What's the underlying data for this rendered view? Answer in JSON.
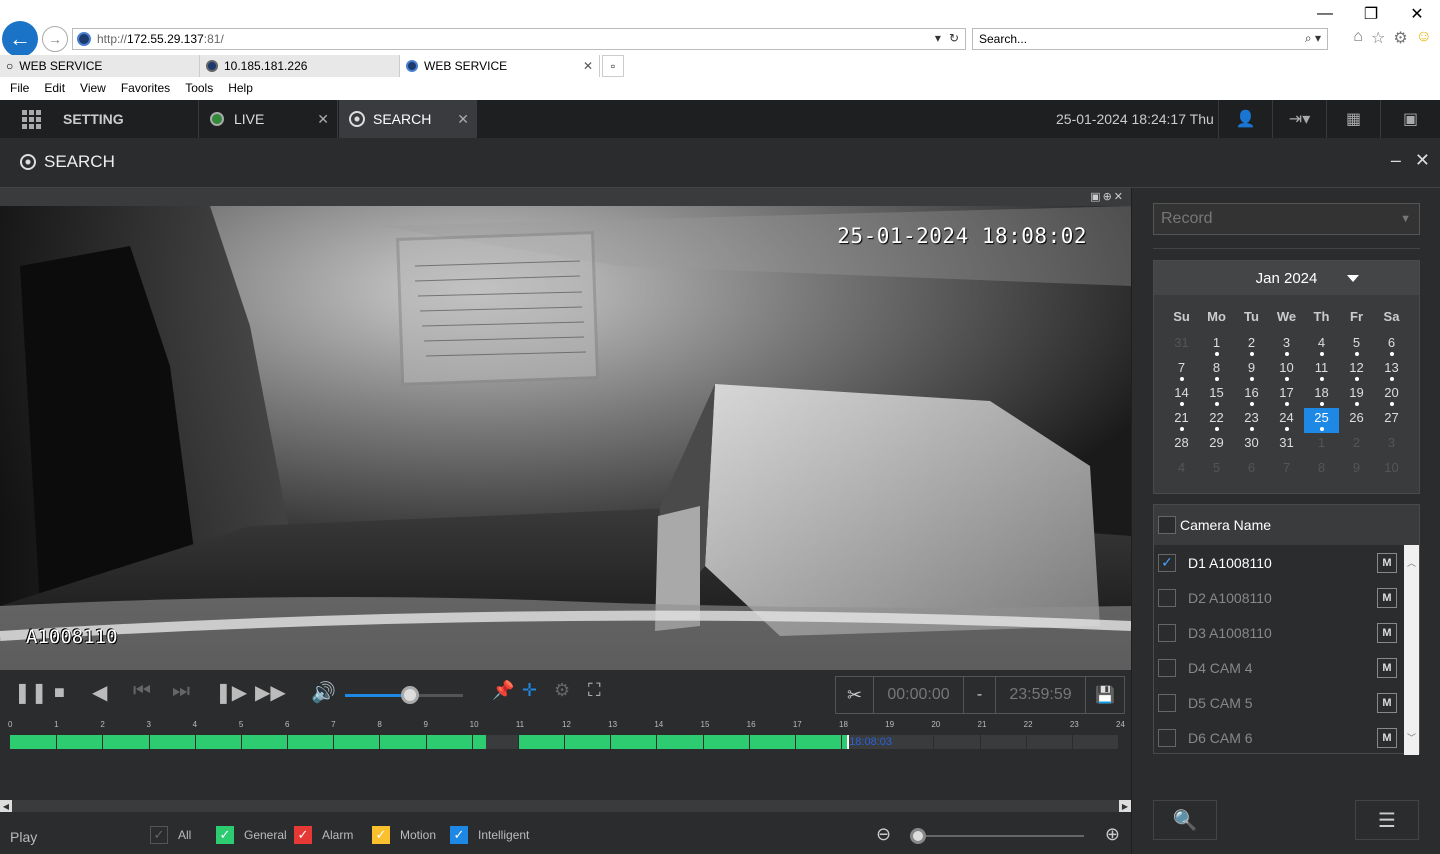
{
  "browser": {
    "url_prefix": "http://",
    "url_host": "172.55.29.137",
    "url_suffix": ":81/",
    "search_placeholder": "Search...",
    "tabs": [
      {
        "label": "WEB SERVICE"
      },
      {
        "label": "10.185.181.226"
      },
      {
        "label": "WEB SERVICE"
      }
    ],
    "menu": [
      "File",
      "Edit",
      "View",
      "Favorites",
      "Tools",
      "Help"
    ]
  },
  "app": {
    "setting_label": "SETTING",
    "tab_live": "LIVE",
    "tab_search": "SEARCH",
    "datetime": "25-01-2024 18:24:17 Thu"
  },
  "search_panel": {
    "title": "SEARCH"
  },
  "video": {
    "osd_time": "25-01-2024 18:08:02",
    "osd_camera": "A1008110"
  },
  "playback": {
    "clip_start": "00:00:00",
    "clip_sep": "-",
    "clip_end": "23:59:59",
    "volume_level": 0.55
  },
  "timeline": {
    "hours": [
      "0",
      "1",
      "2",
      "3",
      "4",
      "5",
      "6",
      "7",
      "8",
      "9",
      "10",
      "11",
      "12",
      "13",
      "14",
      "15",
      "16",
      "17",
      "18",
      "19",
      "20",
      "21",
      "22",
      "23",
      "24"
    ],
    "cursor_time": "18:08:03",
    "recorded_segments": [
      [
        0,
        10.3
      ],
      [
        11.0,
        18.15
      ]
    ]
  },
  "bottom": {
    "play_label": "Play",
    "filters": [
      {
        "label": "All",
        "color": "#2b2c2e"
      },
      {
        "label": "General",
        "color": "#2ecc71"
      },
      {
        "label": "Alarm",
        "color": "#e53935"
      },
      {
        "label": "Motion",
        "color": "#fbc02d"
      },
      {
        "label": "Intelligent",
        "color": "#1e88e5"
      }
    ]
  },
  "right": {
    "record_type": "Record",
    "calendar": {
      "month_label": "Jan 2024",
      "weekdays": [
        "Su",
        "Mo",
        "Tu",
        "We",
        "Th",
        "Fr",
        "Sa"
      ],
      "selected_day": "25"
    },
    "camera_header": "Camera Name",
    "cameras": [
      {
        "name": "D1 A1008110",
        "checked": true
      },
      {
        "name": "D2 A1008110",
        "checked": false
      },
      {
        "name": "D3 A1008110",
        "checked": false
      },
      {
        "name": "D4 CAM 4",
        "checked": false
      },
      {
        "name": "D5 CAM 5",
        "checked": false
      },
      {
        "name": "D6 CAM 6",
        "checked": false
      }
    ],
    "m_label": "M"
  }
}
